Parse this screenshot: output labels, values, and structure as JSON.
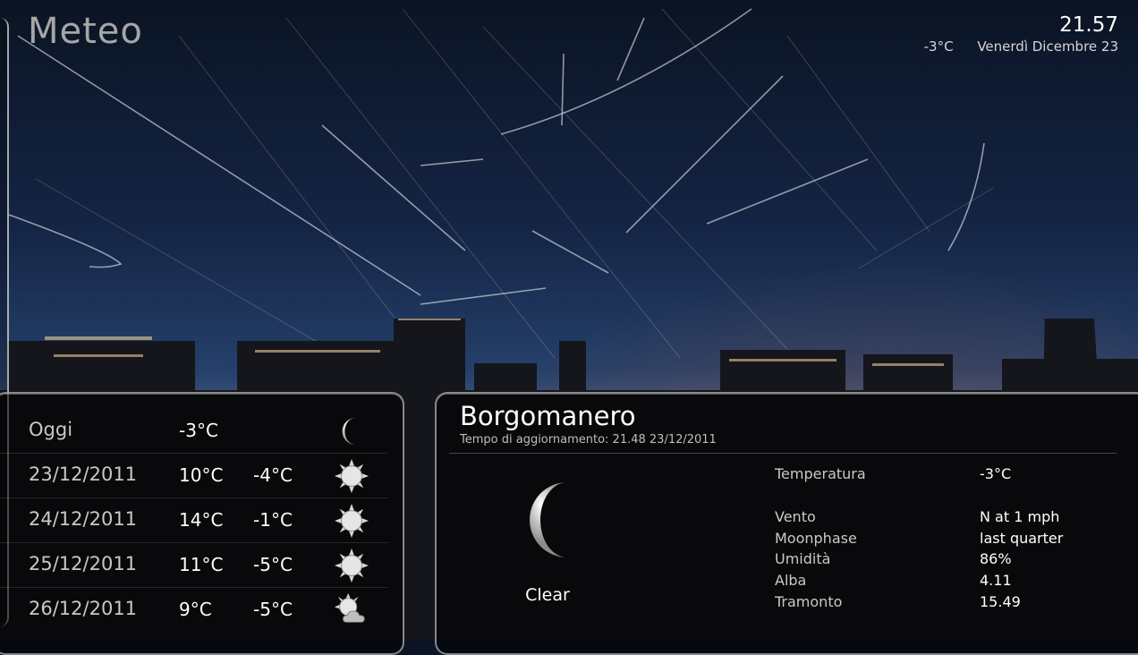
{
  "app": {
    "title": "Meteo"
  },
  "header": {
    "time": "21.57",
    "current_temp": "-3°C",
    "date": "Venerdì Dicembre 23"
  },
  "forecast": [
    {
      "day": "Oggi",
      "high": "-3°C",
      "low": "",
      "icon": "moon-icon"
    },
    {
      "day": "23/12/2011",
      "high": "10°C",
      "low": "-4°C",
      "icon": "sun-icon"
    },
    {
      "day": "24/12/2011",
      "high": "14°C",
      "low": "-1°C",
      "icon": "sun-icon"
    },
    {
      "day": "25/12/2011",
      "high": "11°C",
      "low": "-5°C",
      "icon": "sun-icon"
    },
    {
      "day": "26/12/2011",
      "high": "9°C",
      "low": "-5°C",
      "icon": "partly-cloudy-icon"
    }
  ],
  "details": {
    "city": "Borgomanero",
    "updated": "Tempo di aggiornamento: 21.48 23/12/2011",
    "condition": "Clear",
    "condition_icon": "moon-icon",
    "rows": [
      {
        "label": "Temperatura",
        "value": "-3°C"
      },
      {
        "label": "Vento",
        "value": "N at 1 mph"
      },
      {
        "label": "Moonphase",
        "value": "last quarter"
      },
      {
        "label": "Umidità",
        "value": "86%"
      },
      {
        "label": "Alba",
        "value": "4.11"
      },
      {
        "label": "Tramonto",
        "value": "15.49"
      }
    ]
  }
}
